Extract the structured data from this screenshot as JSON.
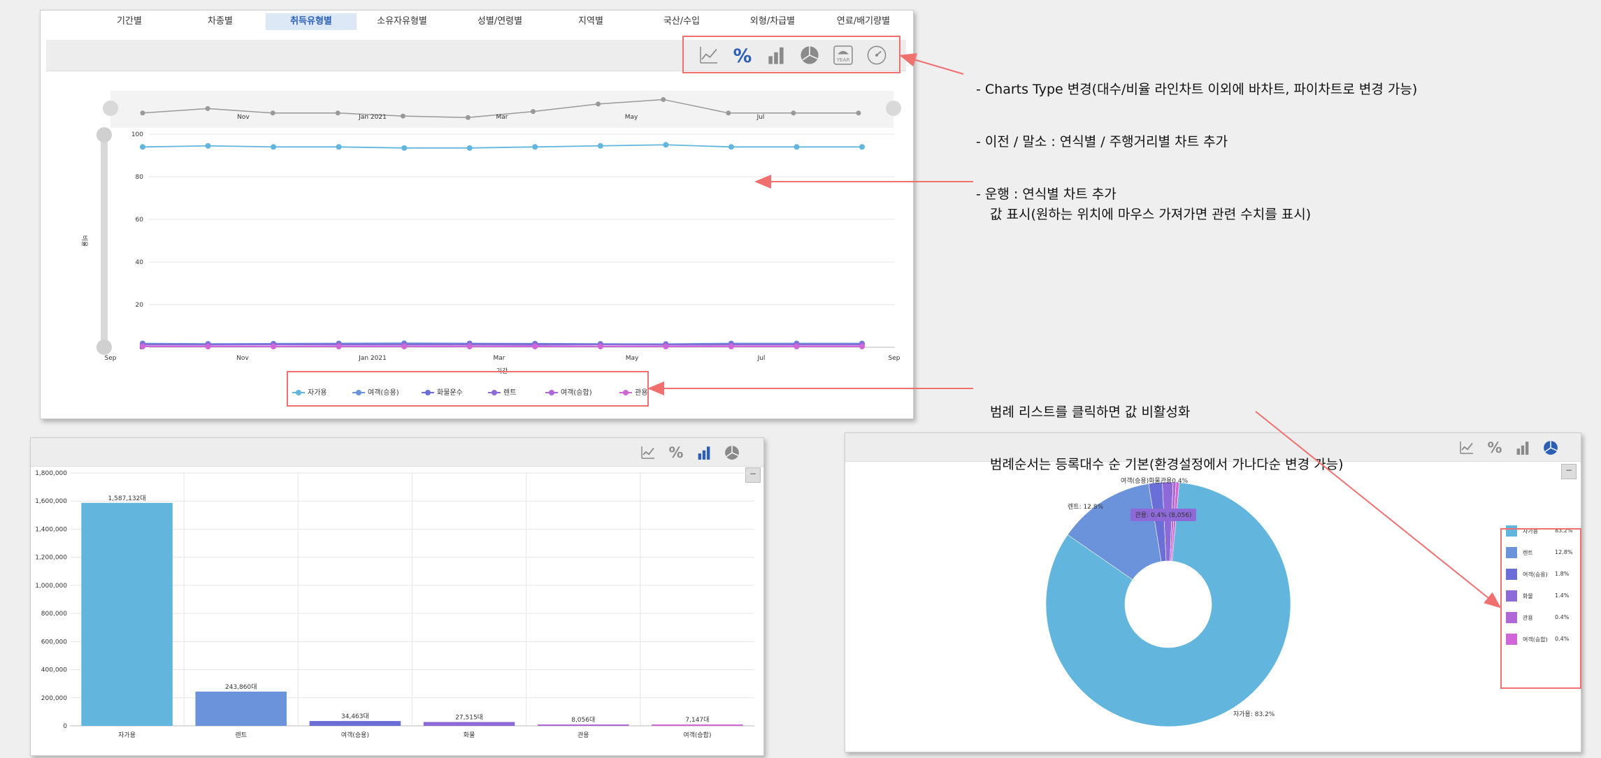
{
  "tabs": [
    {
      "label": "기간별",
      "active": false
    },
    {
      "label": "차종별",
      "active": false
    },
    {
      "label": "취득유형별",
      "active": true
    },
    {
      "label": "소유자유형별",
      "active": false
    },
    {
      "label": "성별/연령별",
      "active": false
    },
    {
      "label": "지역별",
      "active": false
    },
    {
      "label": "국산/수입",
      "active": false
    },
    {
      "label": "외형/차급별",
      "active": false
    },
    {
      "label": "연료/배기량별",
      "active": false
    }
  ],
  "chart_type_icons": [
    "line-chart-icon",
    "percent-icon",
    "bar-chart-icon",
    "pie-chart-icon",
    "year-icon",
    "gauge-icon"
  ],
  "year_icon_label": "YEAR",
  "colors": {
    "accent": "#2b5fb5",
    "annotation": "#f07070",
    "s1": "#62b6dd",
    "s2": "#6a93db",
    "s3": "#6a6fd8",
    "s4": "#8e6ad8",
    "s5": "#b067d8",
    "s6": "#d066d8"
  },
  "annotations": {
    "charts_type": [
      "- Charts Type 변경(대수/비율 라인차트 이외에 바차트, 파이차트로 변경 가능)",
      "- 이전 / 말소 : 연식별 / 주행거리별 차트 추가",
      "- 운행 : 연식별 차트 추가"
    ],
    "value_display": "값 표시(원하는 위치에 마우스 가져가면 관련 수치를 표시)",
    "legend": [
      "범례 리스트를 클릭하면 값 비활성화",
      "범례순서는 등록대수 순 기본(환경설정에서 가나다순 변경 가능)"
    ]
  },
  "chart_data": [
    {
      "type": "line",
      "xlabel": "기간",
      "ylabel": "비율",
      "ylim": [
        0,
        100
      ],
      "x_ticks": [
        "Sep",
        "Nov",
        "Jan 2021",
        "Mar",
        "May",
        "Jul",
        "Sep"
      ],
      "navigator_ticks": [
        "Nov",
        "Jan 2021",
        "Mar",
        "May",
        "Jul"
      ],
      "y_ticks": [
        "0",
        "20",
        "40",
        "60",
        "80",
        "100"
      ],
      "series": [
        {
          "name": "자가용",
          "values": [
            94,
            94.5,
            94,
            94,
            93.5,
            93.5,
            94,
            94.5,
            95,
            94,
            94,
            94
          ]
        },
        {
          "name": "여객(승용)",
          "values": [
            1.8,
            1.6,
            1.7,
            1.8,
            1.9,
            1.8,
            1.7,
            1.6,
            1.5,
            1.8,
            1.8,
            1.8
          ]
        },
        {
          "name": "화물운수",
          "values": [
            1.4,
            1.3,
            1.4,
            1.5,
            1.4,
            1.6,
            1.5,
            1.3,
            1.3,
            1.4,
            1.4,
            1.4
          ]
        },
        {
          "name": "렌트",
          "values": [
            1.2,
            1.1,
            1.2,
            1.2,
            1.2,
            1.2,
            1.1,
            1.2,
            1.1,
            1.2,
            1.2,
            1.2
          ]
        },
        {
          "name": "여객(승합)",
          "values": [
            0.5,
            0.4,
            0.4,
            0.5,
            0.5,
            0.5,
            0.5,
            0.4,
            0.4,
            0.5,
            0.5,
            0.5
          ]
        },
        {
          "name": "관용",
          "values": [
            0.3,
            0.3,
            0.3,
            0.3,
            0.3,
            0.3,
            0.3,
            0.3,
            0.3,
            0.3,
            0.3,
            0.3
          ]
        }
      ],
      "navigator_values": [
        8,
        11,
        8,
        8,
        6,
        5,
        9,
        14,
        17,
        8,
        8,
        8
      ]
    },
    {
      "type": "bar",
      "categories": [
        "자가용",
        "렌트",
        "여객(승용)",
        "화물",
        "관용",
        "여객(승합)"
      ],
      "values": [
        1587132,
        243860,
        34463,
        27515,
        8056,
        7147
      ],
      "data_labels": [
        "1,587,132대",
        "243,860대",
        "34,463대",
        "27,515대",
        "8,056대",
        "7,147대"
      ],
      "ylim": [
        0,
        1800000
      ],
      "y_ticks": [
        "0",
        "200,000",
        "400,000",
        "600,000",
        "800,000",
        "1,000,000",
        "1,200,000",
        "1,400,000",
        "1,600,000",
        "1,800,000"
      ]
    },
    {
      "type": "pie",
      "categories": [
        "자가용",
        "렌트",
        "여객(승용)",
        "화물",
        "관용",
        "여객(승합)"
      ],
      "values": [
        83.2,
        12.8,
        1.8,
        1.4,
        0.4,
        0.4
      ],
      "legend_pct": [
        "83.2%",
        "12.8%",
        "1.8%",
        "1.4%",
        "0.4%",
        "0.4%"
      ],
      "labels": {
        "main": "자가용: 83.2%",
        "rent": "렌트: 12.8%",
        "cluster": "여객(승용)화물관용0.4%",
        "tooltip": "관용: 0.4% (8,056)"
      }
    }
  ],
  "collapse_label": "−"
}
